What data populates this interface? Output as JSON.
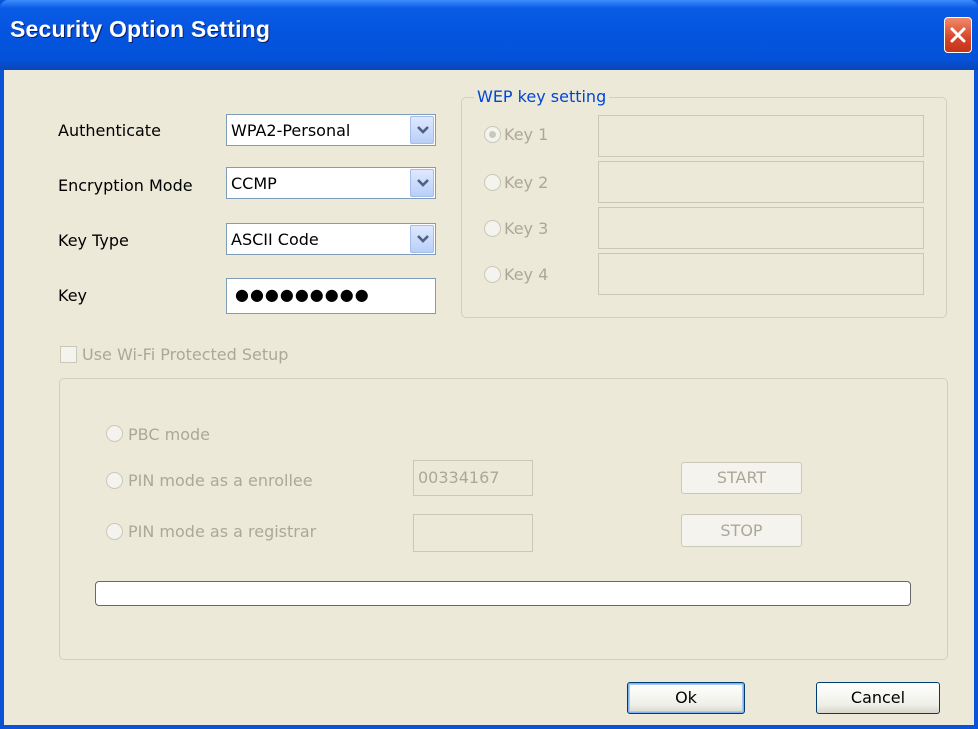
{
  "window": {
    "title": "Security Option Setting"
  },
  "form": {
    "authenticate_label": "Authenticate",
    "authenticate_value": "WPA2-Personal",
    "encryption_label": "Encryption Mode",
    "encryption_value": "CCMP",
    "key_type_label": "Key Type",
    "key_type_value": "ASCII Code",
    "key_label": "Key",
    "key_value_masked": "●●●●●●●●●"
  },
  "wep": {
    "caption": "WEP key setting",
    "keys": [
      {
        "label": "Key 1",
        "selected": true,
        "value": ""
      },
      {
        "label": "Key 2",
        "selected": false,
        "value": ""
      },
      {
        "label": "Key 3",
        "selected": false,
        "value": ""
      },
      {
        "label": "Key 4",
        "selected": false,
        "value": ""
      }
    ]
  },
  "wps": {
    "checkbox_label": "Use Wi-Fi Protected Setup",
    "checked": false,
    "pbc_label": "PBC mode",
    "enrollee_label": "PIN mode as a enrollee",
    "enrollee_pin": "00334167",
    "registrar_label": "PIN mode as a registrar",
    "registrar_pin": "",
    "start_label": "START",
    "stop_label": "STOP",
    "progress": 0
  },
  "buttons": {
    "ok": "Ok",
    "cancel": "Cancel"
  },
  "colors": {
    "titlebar": "#0454e0",
    "dialog_bg": "#ece9d8",
    "group_caption": "#0046d5",
    "disabled_text": "#aca899"
  }
}
